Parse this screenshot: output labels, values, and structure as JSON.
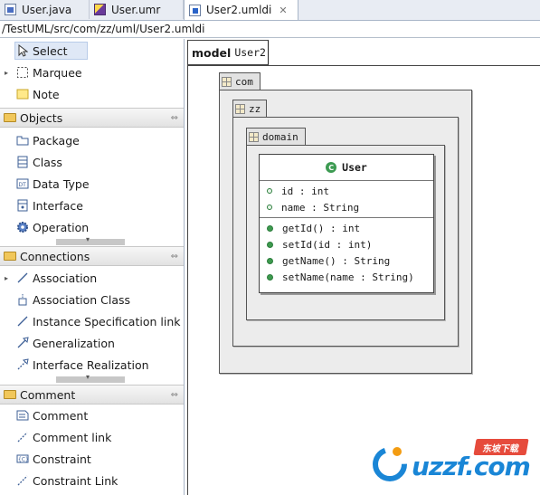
{
  "tabs": [
    {
      "label": "User.java",
      "icon": "java-file-icon",
      "active": false
    },
    {
      "label": "User.umr",
      "icon": "umr-file-icon",
      "active": false
    },
    {
      "label": "User2.umldi",
      "icon": "umldi-file-icon",
      "active": true,
      "close": "✕"
    }
  ],
  "path": "/TestUML/src/com/zz/uml/User2.umldi",
  "palette": {
    "tools": [
      {
        "label": "Select",
        "icon": "select-arrow-icon"
      },
      {
        "label": "Marquee",
        "icon": "marquee-icon"
      },
      {
        "label": "Note",
        "icon": "note-icon"
      }
    ],
    "drawers": [
      {
        "label": "Objects",
        "items": [
          {
            "label": "Package",
            "icon": "package-icon"
          },
          {
            "label": "Class",
            "icon": "class-icon"
          },
          {
            "label": "Data Type",
            "icon": "datatype-icon"
          },
          {
            "label": "Interface",
            "icon": "interface-icon"
          },
          {
            "label": "Operation",
            "icon": "operation-gear-icon"
          }
        ]
      },
      {
        "label": "Connections",
        "items": [
          {
            "label": "Association",
            "icon": "association-icon"
          },
          {
            "label": "Association Class",
            "icon": "association-class-icon"
          },
          {
            "label": "Instance Specification link",
            "icon": "instance-link-icon"
          },
          {
            "label": "Generalization",
            "icon": "generalization-icon"
          },
          {
            "label": "Interface Realization",
            "icon": "interface-realization-icon"
          }
        ]
      },
      {
        "label": "Comment",
        "items": [
          {
            "label": "Comment",
            "icon": "comment-icon"
          },
          {
            "label": "Comment link",
            "icon": "comment-link-icon"
          },
          {
            "label": "Constraint",
            "icon": "constraint-icon"
          },
          {
            "label": "Constraint Link",
            "icon": "constraint-link-icon"
          }
        ]
      }
    ]
  },
  "diagram": {
    "model_keyword": "model",
    "model_name": "User2",
    "packages": [
      "com",
      "zz",
      "domain"
    ],
    "class": {
      "name": "User",
      "attributes": [
        "id : int",
        "name : String"
      ],
      "operations": [
        "getId() : int",
        "setId(id : int)",
        "getName() : String",
        "setName(name : String)"
      ]
    }
  },
  "watermark": {
    "text": "uzzf.com",
    "badge": "东坡下载"
  },
  "colors": {
    "tab_bar": "#e8ecf3",
    "package_fill": "#ececec",
    "class_icon": "#3d9b52",
    "watermark_blue": "#1a86d6",
    "watermark_red": "#e64b3c"
  }
}
